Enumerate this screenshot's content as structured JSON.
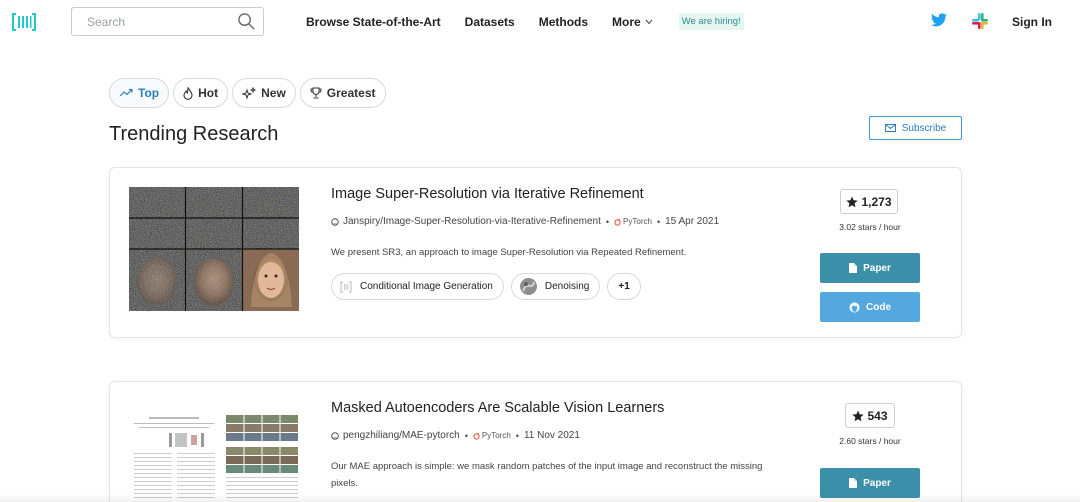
{
  "nav": {
    "search_placeholder": "Search",
    "links": [
      "Browse State-of-the-Art",
      "Datasets",
      "Methods"
    ],
    "more_label": "More",
    "hiring_label": "We are hiring!",
    "signin_label": "Sign In"
  },
  "filters": [
    {
      "label": "Top",
      "icon": "trending-icon",
      "active": true
    },
    {
      "label": "Hot",
      "icon": "flame-icon",
      "active": false
    },
    {
      "label": "New",
      "icon": "sparkle-icon",
      "active": false
    },
    {
      "label": "Greatest",
      "icon": "trophy-icon",
      "active": false
    }
  ],
  "page_title": "Trending Research",
  "subscribe_label": "Subscribe",
  "papers": [
    {
      "title": "Image Super-Resolution via Iterative Refinement",
      "repo": "Janspiry/Image-Super-Resolution-via-Iterative-Refinement",
      "framework": "PyTorch",
      "date": "15 Apr 2021",
      "abstract": "We present SR3, an approach to image Super-Resolution via Repeated Refinement.",
      "tasks": [
        "Conditional Image Generation",
        "Denoising"
      ],
      "more_tasks": "+1",
      "stars": "1,273",
      "rate": "3.02 stars / hour",
      "paper_label": "Paper",
      "code_label": "Code"
    },
    {
      "title": "Masked Autoencoders Are Scalable Vision Learners",
      "repo": "pengzhiliang/MAE-pytorch",
      "framework": "PyTorch",
      "date": "11 Nov 2021",
      "abstract": "Our MAE approach is simple: we mask random patches of the input image and reconstruct the missing pixels.",
      "stars": "543",
      "rate": "2.60 stars / hour",
      "paper_label": "Paper"
    }
  ],
  "colors": {
    "accent": "#2a7fb9",
    "paper_button": "#3b8fa8",
    "code_button": "#55a8df",
    "logo": "#21cbce",
    "twitter": "#1da1f2"
  }
}
